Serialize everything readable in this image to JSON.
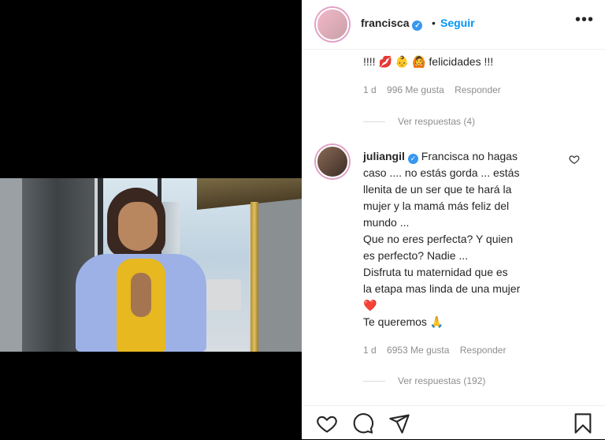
{
  "post": {
    "username": "francisca",
    "follow_label": "Seguir",
    "dot": "•",
    "more": "•••"
  },
  "comment1": {
    "text": "!!!! 💋 👶 🙆 felicidades !!!",
    "time": "1 d",
    "likes": "996 Me gusta",
    "reply": "Responder",
    "view_replies": "Ver respuestas (4)"
  },
  "comment2": {
    "username": "juliangil",
    "lines": [
      "Francisca no hagas",
      "caso .... no estás gorda ... estás",
      "llenita de un ser que te hará la",
      "mujer y la mamá más feliz del",
      "mundo ...",
      "Que no eres perfecta? Y quien",
      "es perfecto? Nadie ...",
      "Disfruta tu maternidad que es",
      "la etapa mas linda de una mujer",
      "❤️",
      "Te queremos 🙏"
    ],
    "time": "1 d",
    "likes": "6953 Me gusta",
    "reply": "Responder",
    "view_replies": "Ver respuestas (192)"
  },
  "icons": {
    "verified": "verified-badge-icon",
    "heart": "heart-icon",
    "comment": "comment-icon",
    "share": "share-icon",
    "save": "bookmark-icon"
  },
  "colors": {
    "link": "#0095f6",
    "muted": "#8e8e8e",
    "verified": "#3897f0"
  }
}
